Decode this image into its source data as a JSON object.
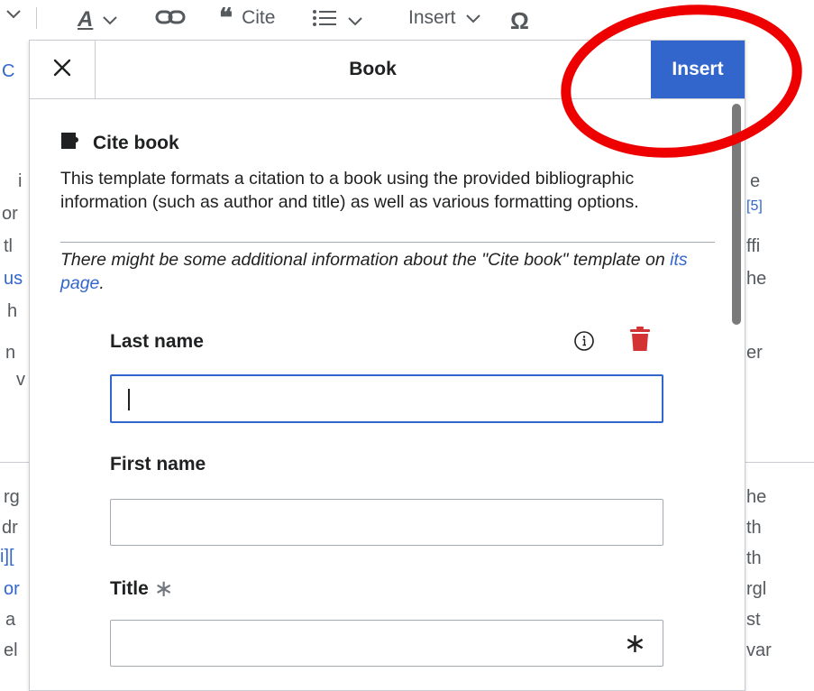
{
  "toolbar": {
    "cite_label": "Cite",
    "insert_label": "Insert"
  },
  "background_article": {
    "left_fragments": [
      "C",
      "i",
      "or",
      "tl",
      "us",
      "h",
      "n",
      "v",
      "rg",
      "dr",
      "i][",
      "or",
      "a",
      "el"
    ],
    "right_fragments": [
      "e",
      "[5]",
      "ffi",
      "he",
      "er",
      "he",
      "th",
      "th",
      "rgl",
      "st",
      "var"
    ]
  },
  "dialog": {
    "title": "Book",
    "insert_label": "Insert",
    "template_name": "Cite book",
    "description": "This template formats a citation to a book using the provided bibliographic information (such as author and title) as well as various formatting options.",
    "note_prefix": "There might be some additional information about the \"Cite book\" template on ",
    "note_link": "its page",
    "note_suffix": "."
  },
  "fields": [
    {
      "label": "Last name",
      "value": "",
      "required": false
    },
    {
      "label": "First name",
      "value": "",
      "required": false
    },
    {
      "label": "Title",
      "value": "",
      "required": true,
      "required_mark": "∗"
    }
  ],
  "colors": {
    "accent": "#3366cc",
    "delete": "#d33333",
    "annotation": "#ee0000"
  }
}
